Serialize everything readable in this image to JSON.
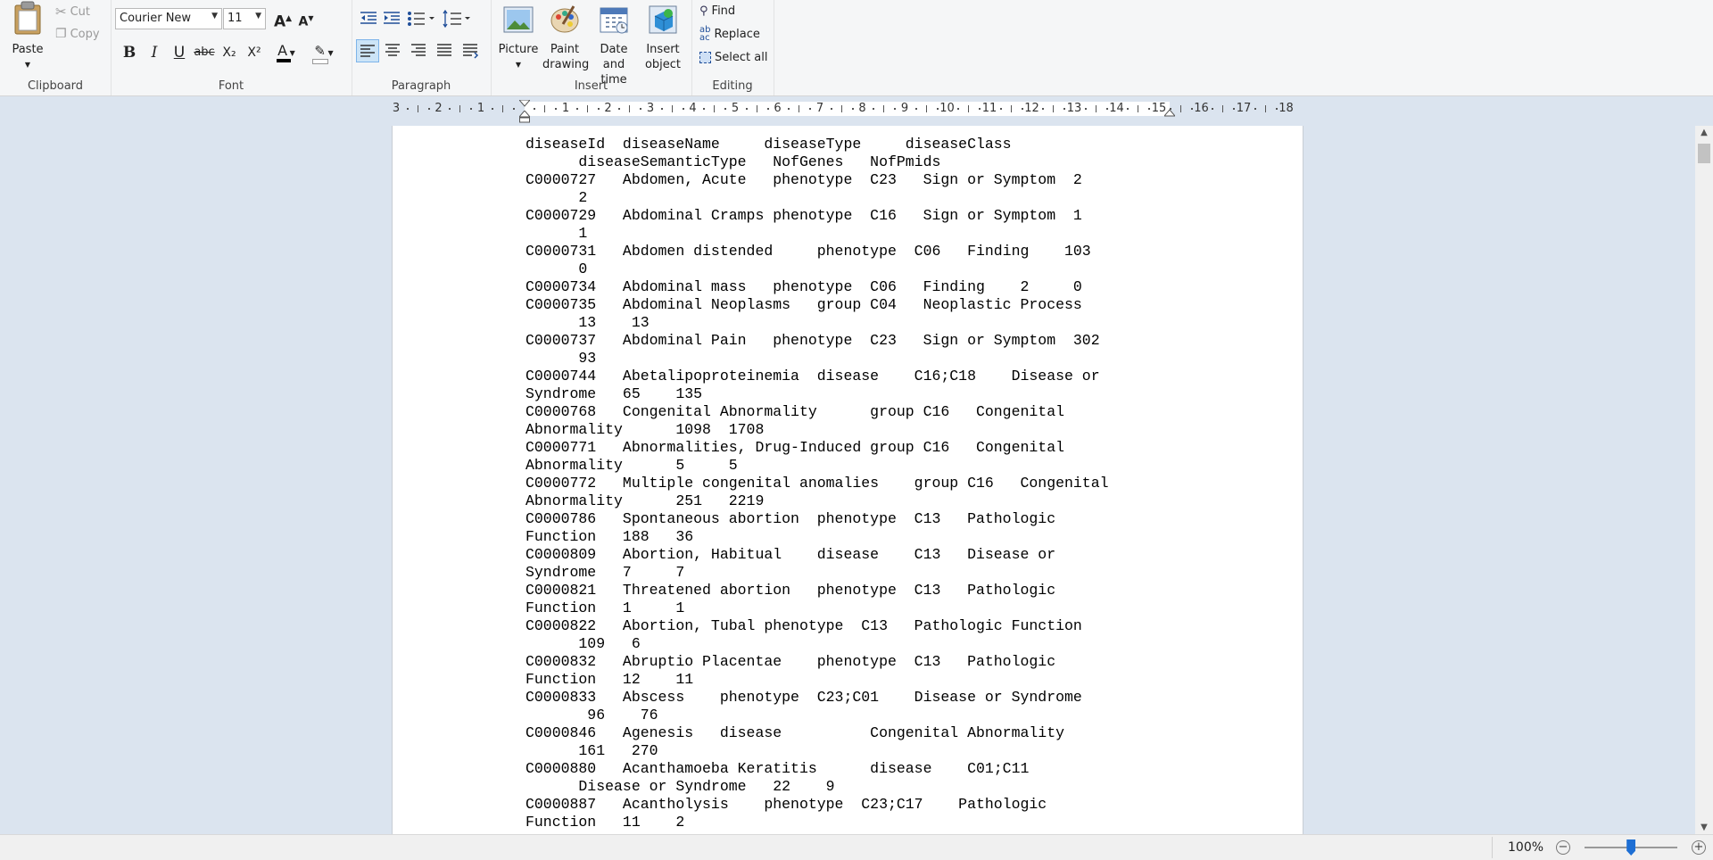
{
  "ribbon": {
    "clipboard": {
      "label": "Clipboard",
      "paste": "Paste",
      "cut": "Cut",
      "copy": "Copy"
    },
    "font": {
      "label": "Font",
      "family": "Courier New",
      "size": "11",
      "bold": "B",
      "italic": "I",
      "underline": "U",
      "strike": "abc",
      "sub": "X₂",
      "sup": "X²",
      "color_letter": "A",
      "text_color": "#000000",
      "highlight_color": "#ffffff"
    },
    "paragraph": {
      "label": "Paragraph"
    },
    "insert": {
      "label": "Insert",
      "picture": "Picture",
      "paint1": "Paint",
      "paint2": "drawing",
      "date1": "Date and",
      "date2": "time",
      "obj1": "Insert",
      "obj2": "object"
    },
    "editing": {
      "label": "Editing",
      "find": "Find",
      "replace": "Replace",
      "select_all": "Select all"
    }
  },
  "ruler": {
    "labels": [
      "3",
      "2",
      "1",
      "",
      "1",
      "2",
      "3",
      "4",
      "5",
      "6",
      "7",
      "8",
      "9",
      "10",
      "11",
      "12",
      "13",
      "14",
      "15",
      "16",
      "17",
      "18"
    ]
  },
  "document": {
    "lines": [
      "diseaseId  diseaseName     diseaseType     diseaseClass",
      "      diseaseSemanticType   NofGenes   NofPmids",
      "C0000727   Abdomen, Acute   phenotype  C23   Sign or Symptom  2",
      "      2",
      "C0000729   Abdominal Cramps phenotype  C16   Sign or Symptom  1",
      "      1",
      "C0000731   Abdomen distended     phenotype  C06   Finding    103",
      "      0",
      "C0000734   Abdominal mass   phenotype  C06   Finding    2     0",
      "C0000735   Abdominal Neoplasms   group C04   Neoplastic Process",
      "      13    13",
      "C0000737   Abdominal Pain   phenotype  C23   Sign or Symptom  302",
      "      93",
      "C0000744   Abetalipoproteinemia  disease    C16;C18    Disease or",
      "Syndrome   65    135",
      "C0000768   Congenital Abnormality      group C16   Congenital",
      "Abnormality      1098  1708",
      "C0000771   Abnormalities, Drug-Induced group C16   Congenital",
      "Abnormality      5     5",
      "C0000772   Multiple congenital anomalies    group C16   Congenital",
      "Abnormality      251   2219",
      "C0000786   Spontaneous abortion  phenotype  C13   Pathologic",
      "Function   188   36",
      "C0000809   Abortion, Habitual    disease    C13   Disease or",
      "Syndrome   7     7",
      "C0000821   Threatened abortion   phenotype  C13   Pathologic",
      "Function   1     1",
      "C0000822   Abortion, Tubal phenotype  C13   Pathologic Function",
      "      109   6",
      "C0000832   Abruptio Placentae    phenotype  C13   Pathologic",
      "Function   12    11",
      "C0000833   Abscess    phenotype  C23;C01    Disease or Syndrome",
      "       96    76",
      "C0000846   Agenesis   disease          Congenital Abnormality",
      "      161   270",
      "C0000880   Acanthamoeba Keratitis      disease    C01;C11",
      "      Disease or Syndrome   22    9",
      "C0000887   Acantholysis    phenotype  C23;C17    Pathologic",
      "Function   11    2"
    ]
  },
  "status": {
    "zoom": "100%",
    "minus": "−",
    "plus": "+",
    "zoom_level_pct": 30
  }
}
